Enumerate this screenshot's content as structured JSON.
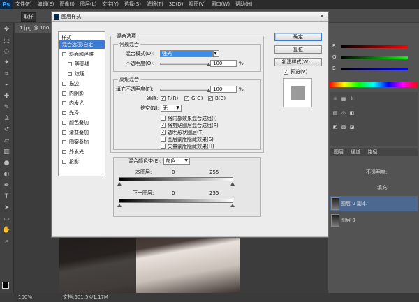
{
  "app": {
    "logo": "Ps",
    "menu": [
      "文件(F)",
      "编辑(E)",
      "图像(I)",
      "图层(L)",
      "文字(Y)",
      "选择(S)",
      "滤镜(T)",
      "3D(D)",
      "视图(V)",
      "窗口(W)",
      "帮助(H)"
    ],
    "options_sample": "取样",
    "document_tab": "1.jpg @ 100",
    "status_zoom": "100%",
    "status_doc": "文档:601.5K/1.17M"
  },
  "panels": {
    "color_labels": [
      "R",
      "G",
      "B"
    ],
    "layer_tabs": [
      "图层",
      "通道",
      "路径"
    ],
    "opacity_label": "不透明度:",
    "fill_label": "填充:",
    "layers": [
      {
        "name": "图层 0 副本",
        "selected": true
      },
      {
        "name": "图层 0",
        "selected": false
      }
    ]
  },
  "dialog": {
    "title": "图层样式",
    "styles_header": "样式",
    "styles": [
      {
        "label": "混合选项:自定",
        "active": true,
        "sub": false,
        "checked": false
      },
      {
        "label": "斜面和浮雕",
        "active": false,
        "sub": false,
        "checked": false
      },
      {
        "label": "等高线",
        "active": false,
        "sub": true,
        "checked": false
      },
      {
        "label": "纹理",
        "active": false,
        "sub": true,
        "checked": false
      },
      {
        "label": "描边",
        "active": false,
        "sub": false,
        "checked": false
      },
      {
        "label": "内阴影",
        "active": false,
        "sub": false,
        "checked": false
      },
      {
        "label": "内发光",
        "active": false,
        "sub": false,
        "checked": false
      },
      {
        "label": "光泽",
        "active": false,
        "sub": false,
        "checked": false
      },
      {
        "label": "颜色叠加",
        "active": false,
        "sub": false,
        "checked": false
      },
      {
        "label": "渐变叠加",
        "active": false,
        "sub": false,
        "checked": false
      },
      {
        "label": "图案叠加",
        "active": false,
        "sub": false,
        "checked": false
      },
      {
        "label": "外发光",
        "active": false,
        "sub": false,
        "checked": false
      },
      {
        "label": "投影",
        "active": false,
        "sub": false,
        "checked": false
      }
    ],
    "blend_options_group": "混合选项",
    "general_group": "常规混合",
    "blend_mode_label": "混合模式(D):",
    "blend_mode_value": "强光",
    "opacity_label": "不透明度(O):",
    "opacity_value": "100",
    "opacity_fraction": 1.0,
    "advanced_group": "高级混合",
    "fill_opacity_label": "填充不透明度(F):",
    "fill_opacity_value": "100",
    "fill_opacity_fraction": 1.0,
    "percent": "%",
    "channels_label": "通道:",
    "channels": [
      {
        "label": "R(R)",
        "checked": true
      },
      {
        "label": "G(G)",
        "checked": true
      },
      {
        "label": "B(B)",
        "checked": true
      }
    ],
    "knockout_label": "挖空(N):",
    "knockout_value": "无",
    "advanced_options": [
      {
        "label": "将内部效果混合成组(I)",
        "checked": false
      },
      {
        "label": "将剪贴图层混合成组(P)",
        "checked": true
      },
      {
        "label": "透明形状图层(T)",
        "checked": true
      },
      {
        "label": "图层蒙版隐藏效果(S)",
        "checked": false
      },
      {
        "label": "矢量蒙版隐藏效果(H)",
        "checked": false
      }
    ],
    "blend_if_label": "混合颜色带(E):",
    "blend_if_value": "灰色",
    "this_layer_label": "本图层:",
    "this_layer_min": "0",
    "this_layer_max": "255",
    "underlying_label": "下一图层:",
    "underlying_min": "0",
    "underlying_max": "255",
    "buttons": {
      "ok": "确定",
      "reset": "复位",
      "new_style": "新建样式(W)...",
      "preview": "预览(V)"
    },
    "preview_checked": true
  }
}
